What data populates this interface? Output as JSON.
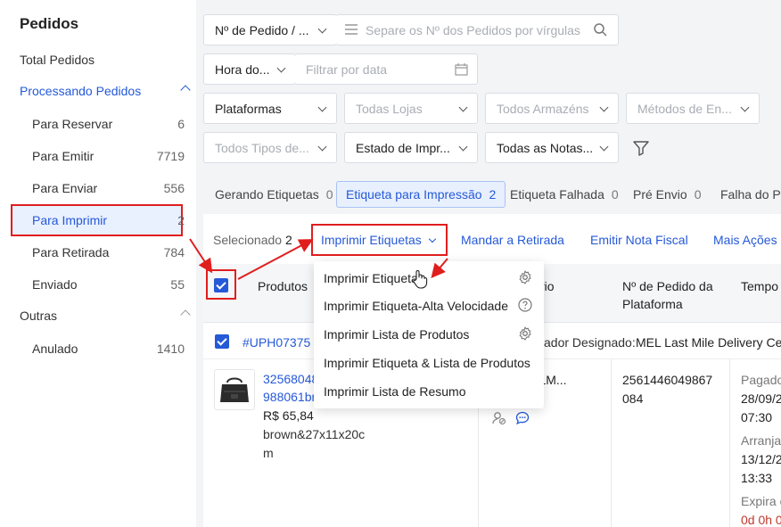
{
  "sidebar": {
    "title": "Pedidos",
    "total": "Total Pedidos",
    "processing": "Processando Pedidos",
    "items": [
      {
        "label": "Para Reservar",
        "count": "6"
      },
      {
        "label": "Para Emitir",
        "count": "7719"
      },
      {
        "label": "Para Enviar",
        "count": "556"
      },
      {
        "label": "Para Imprimir",
        "count": "2"
      },
      {
        "label": "Para Retirada",
        "count": "784"
      },
      {
        "label": "Enviado",
        "count": "55"
      }
    ],
    "others": "Outras",
    "other_items": [
      {
        "label": "Anulado",
        "count": "1410"
      }
    ]
  },
  "filters": {
    "order_type": "Nº de Pedido / ...",
    "order_search_placeholder": "Separe os Nº dos Pedidos por vírgulas",
    "time_type": "Hora do...",
    "date_placeholder": "Filtrar por data",
    "platforms": "Plataformas",
    "stores": "Todas Lojas",
    "warehouses": "Todos Armazéns",
    "shipping_methods": "Métodos de En...",
    "types": "Todos Tipos de...",
    "print_status": "Estado de Impr...",
    "invoices": "Todas as Notas..."
  },
  "tabs": [
    {
      "label": "Gerando Etiquetas",
      "count": "0"
    },
    {
      "label": "Etiqueta para Impressão",
      "count": "2"
    },
    {
      "label": "Etiqueta Falhada",
      "count": "0"
    },
    {
      "label": "Pré Envio",
      "count": "0"
    },
    {
      "label": "Falha do Pr"
    }
  ],
  "actions": {
    "selected_label": "Selecionado",
    "selected_count": "2",
    "print_labels": "Imprimir Etiquetas",
    "send_pickup": "Mandar a Retirada",
    "issue_invoice": "Emitir Nota Fiscal",
    "more": "Mais Ações"
  },
  "columns": {
    "products": "Produtos",
    "partial": "rio",
    "platform_order_line1": "Nº de Pedido da",
    "platform_order_line2": "Plataforma",
    "time": "Tempo"
  },
  "menu_items": [
    {
      "label": "Imprimir Etiqueta",
      "icon": "gear-icon"
    },
    {
      "label": "Imprimir Etiqueta-Alta Velocidade",
      "icon": "help-circle-icon"
    },
    {
      "label": "Imprimir Lista de Produtos",
      "icon": "gear-icon"
    },
    {
      "label": "Imprimir Etiqueta & Lista de Produtos"
    },
    {
      "label": "Imprimir Lista de Resumo"
    }
  ],
  "order": {
    "id": "#UPH07375",
    "logistics_label": "ador Designado:",
    "logistics_value": "MEL Last Mile Delivery Ce",
    "sku_line1": "32568048",
    "sku_line2": "988061br",
    "price": "R$ 65,84",
    "variant_line1": "brown&27x11x20c",
    "variant_line2": "m",
    "buyer": "A COLM...",
    "platform_order_line1": "2561446049867",
    "platform_order_line2": "084",
    "paid_label": "Pagado",
    "paid_date": "28/09/2",
    "paid_time": "07:30",
    "arranged_label": "Arranja",
    "arranged_date": "13/12/2",
    "arranged_time": "13:33",
    "expire_label": "Expira e",
    "expire_value": "0d 0h 0"
  },
  "colors": {
    "accent": "#2559d8",
    "highlight": "#e01e1e",
    "expire": "#c0392b"
  }
}
